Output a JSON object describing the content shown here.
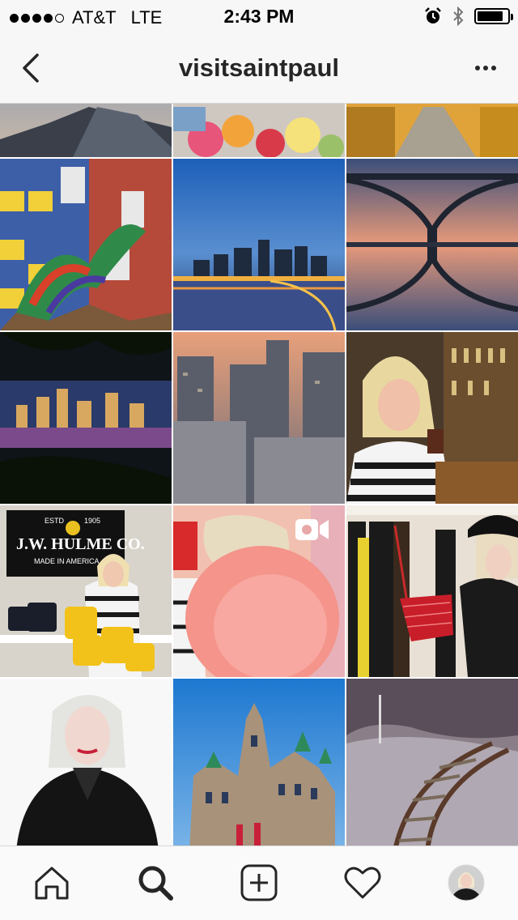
{
  "status_bar": {
    "carrier": "AT&T",
    "network": "LTE",
    "time": "2:43 PM",
    "signal_bars": 4,
    "signal_total": 5,
    "battery_level": 0.85
  },
  "header": {
    "title": "visitsaintpaul",
    "back_icon": "chevron-left-icon",
    "more_icon": "more-horizontal-icon"
  },
  "grid": {
    "columns": 3,
    "posts": [
      {
        "subject": "rocky shoreline"
      },
      {
        "subject": "flower bouquet"
      },
      {
        "subject": "train corridor"
      },
      {
        "subject": "dragon mural"
      },
      {
        "subject": "city skyline at dusk over river"
      },
      {
        "subject": "arch bridge reflection"
      },
      {
        "subject": "skyline through trees"
      },
      {
        "subject": "downtown buildings at sunset"
      },
      {
        "subject": "woman at bar with drink"
      },
      {
        "subject": "J.W. HULME CO. store",
        "sign_text": [
          "ESTD",
          "1905",
          "J.W. HULME CO.",
          "MADE IN AMERICA"
        ]
      },
      {
        "subject": "pink feather video",
        "is_video": true
      },
      {
        "subject": "woman with red bag"
      },
      {
        "subject": "woman portrait"
      },
      {
        "subject": "historic castle building"
      },
      {
        "subject": "railroad tracks"
      }
    ]
  },
  "tab_bar": {
    "items": [
      {
        "name": "home",
        "icon": "home-icon"
      },
      {
        "name": "search",
        "icon": "search-icon",
        "active": true
      },
      {
        "name": "add",
        "icon": "plus-square-icon"
      },
      {
        "name": "activity",
        "icon": "heart-icon"
      },
      {
        "name": "profile",
        "icon": "avatar"
      }
    ]
  }
}
